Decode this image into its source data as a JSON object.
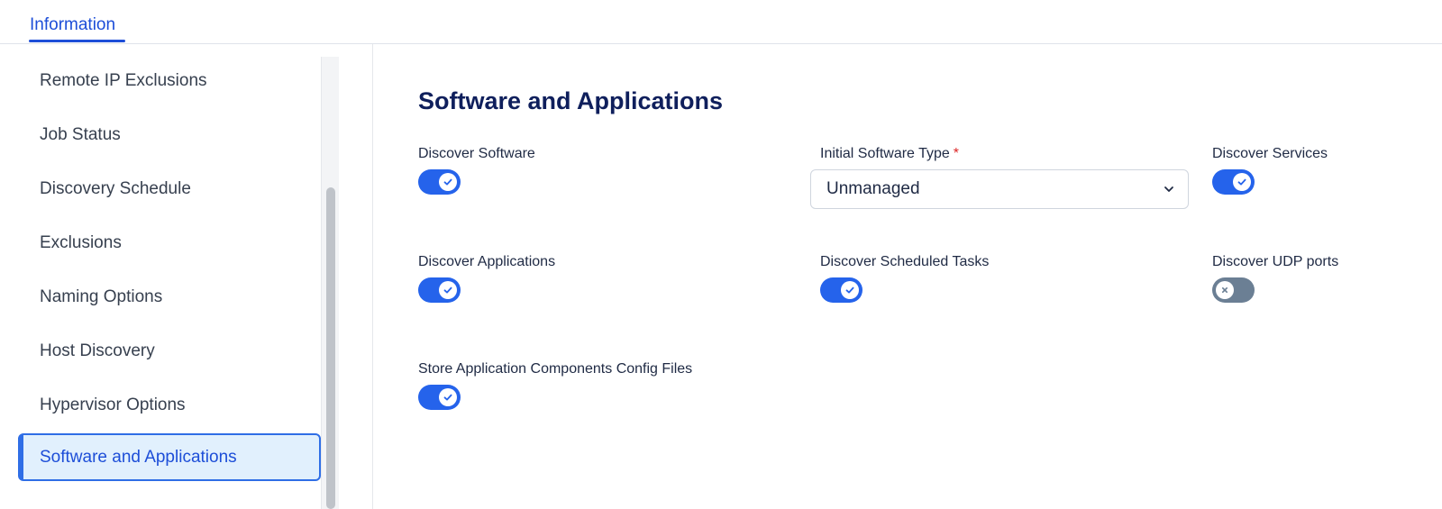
{
  "tabs": {
    "active_label": "Information"
  },
  "sidebar": {
    "items": [
      {
        "label": "Remote IP Exclusions"
      },
      {
        "label": "Job Status"
      },
      {
        "label": "Discovery Schedule"
      },
      {
        "label": "Exclusions"
      },
      {
        "label": "Naming Options"
      },
      {
        "label": "Host Discovery"
      },
      {
        "label": "Hypervisor Options"
      },
      {
        "label": "Software and Applications",
        "active": true
      }
    ]
  },
  "main": {
    "title": "Software and Applications",
    "fields": {
      "discover_software": {
        "label": "Discover Software",
        "enabled": true
      },
      "initial_software_type": {
        "label": "Initial Software Type",
        "required_marker": "*",
        "value": "Unmanaged"
      },
      "discover_services": {
        "label": "Discover Services",
        "enabled": true
      },
      "discover_applications": {
        "label": "Discover Applications",
        "enabled": true
      },
      "discover_scheduled_tasks": {
        "label": "Discover Scheduled Tasks",
        "enabled": true
      },
      "discover_udp_ports": {
        "label": "Discover UDP ports",
        "enabled": false
      },
      "store_app_config_files": {
        "label": "Store Application Components Config Files",
        "enabled": true
      }
    }
  },
  "colors": {
    "accent": "#2563eb",
    "toggle_off": "#6b7f94",
    "heading": "#0f1f5c",
    "active_bg": "#e1f0fd",
    "required": "#dc2626"
  }
}
